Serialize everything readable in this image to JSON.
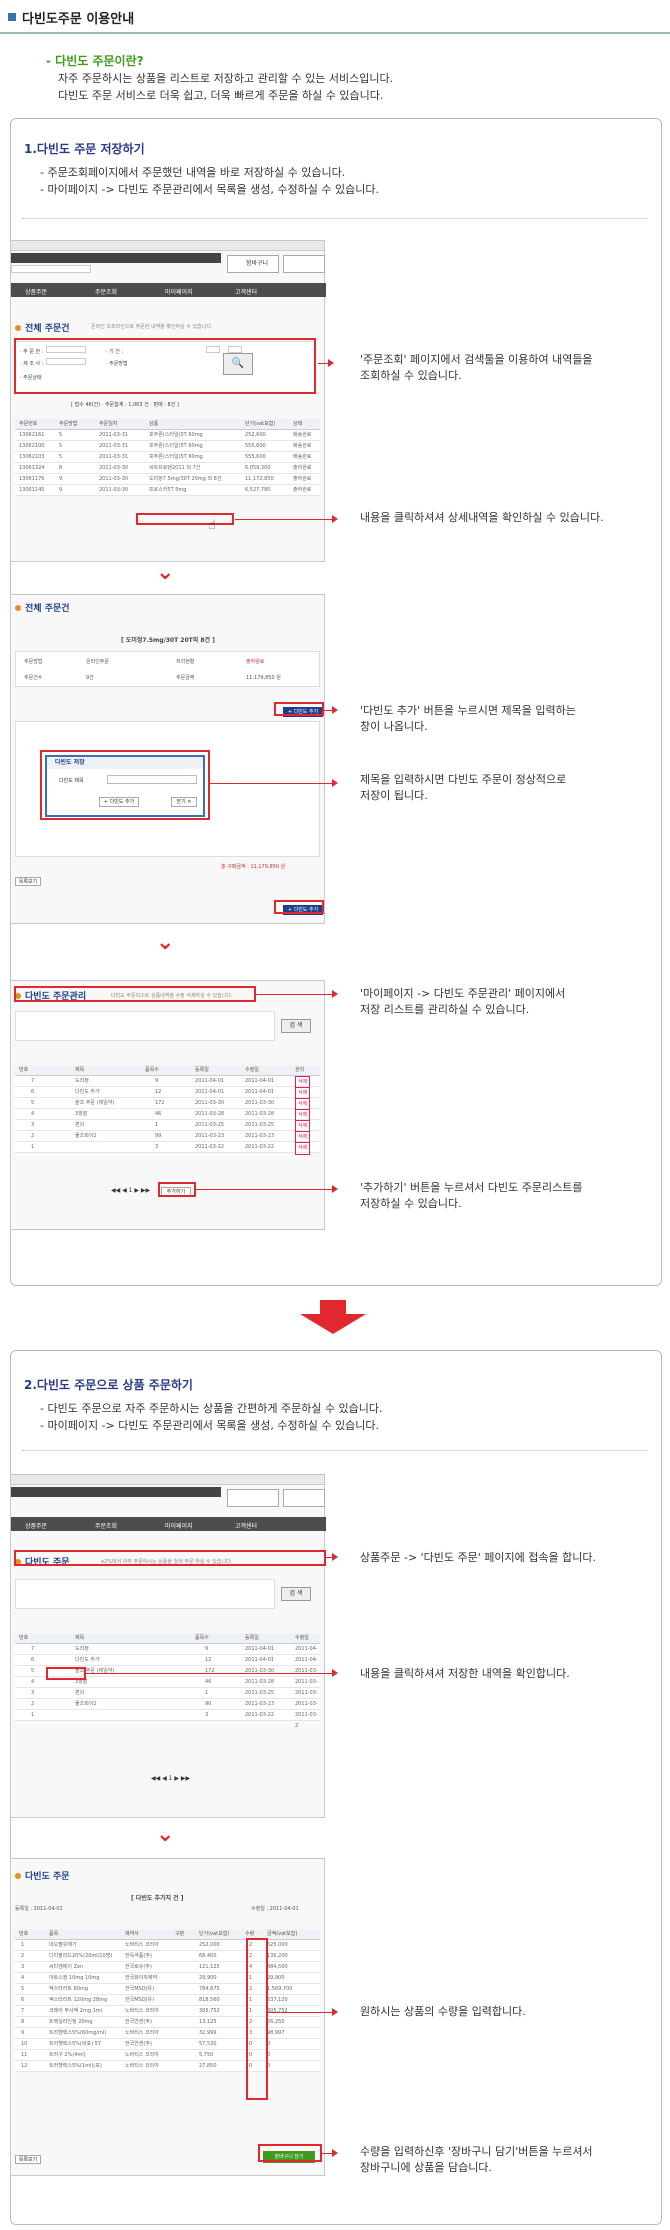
{
  "header": {
    "title": "다빈도주문 이용안내"
  },
  "intro": {
    "question": "- 다빈도 주문이란?",
    "line1": "자주 주문하시는 상품을 리스트로 저장하고 관리할 수 있는 서비스입니다.",
    "line2": "다빈도 주문 서비스로 더욱 쉽고, 더욱 빠르게 주문을 하실 수 있습니다."
  },
  "section1": {
    "title": "1.다빈도 주문 저장하기",
    "bullet1": "- 주문조회페이지에서 주문했던 내역을 바로 저장하실 수 있습니다.",
    "bullet2": "- 마이페이지 -> 다빈도 주문관리에서 목록을 생성, 수정하실 수 있습니다.",
    "annotations": {
      "a1_l1": "'주문조회' 페이지에서 검색툴을 이용하여 내역들을",
      "a1_l2": "조회하실 수 있습니다.",
      "a2": "내용을 클릭하셔셔 상세내역을 확인하실 수 있습니다.",
      "a3_l1": "'다빈도 추가' 버튼을 누르시면 제목을 입력하는",
      "a3_l2": "창이 나옵니다.",
      "a4_l1": "제목을 입력하시면 다빈도 주문이 정상적으로",
      "a4_l2": "저장이 됩니다.",
      "a5_l1": "'마이페이지 -> 다빈도 주문관리' 페이지에서",
      "a5_l2": "저장 리스트를 관리하실 수 있습니다.",
      "a6_l1": "'추가하기' 버튼을 누르셔서 다빈도 주문리스트를",
      "a6_l2": "저장하실 수 있습니다."
    },
    "shot1": {
      "nav": [
        "상품주문",
        "주문조회",
        "마이페이지",
        "고객센터"
      ],
      "cart": "장바구니",
      "section_title": "전체 주문건",
      "section_sub": "온라인 오프라인으로 주문한 내역을 확인하실 수 있습니다.",
      "form": {
        "order_no": "· 주 문 번 :",
        "period": "· 기 간 :",
        "product": "· 제 조 사 :",
        "method": "· 주문방법",
        "status": "· 주문상태"
      },
      "summary": "[ 접수 46(건) · 주문합계 : 1,063 건 · 판매 : 8건 ]",
      "headers": [
        "주문번호",
        "주문방법",
        "주문일자",
        "상품",
        "단가(vat포함)",
        "상태"
      ],
      "rows": [
        [
          "13062161",
          "5",
          "2011-03-31",
          "포주론(스터일)5T 60mg",
          "252,600",
          "배송완료"
        ],
        [
          "13062100",
          "5",
          "2011-03-31",
          "포주론(스터일)5T 60mg",
          "555,600",
          "배송완료"
        ],
        [
          "13062103",
          "5",
          "2011-03-31",
          "포주론(스터일)5T 60mg",
          "555,600",
          "배송완료"
        ],
        [
          "13061324",
          "8",
          "2011-03-30",
          "씨트프로텐2011 외 7건",
          "6,059,300",
          "출하완료"
        ],
        [
          "13061176",
          "9",
          "2011-03-30",
          "도미정7.5mg/30T 20mg 외 8건",
          "11,172,850",
          "출하완료"
        ],
        [
          "13061145",
          "9",
          "2011-03-30",
          "프로스카5T 5mg",
          "6,527,780",
          "출하완료"
        ]
      ]
    },
    "shot2": {
      "section_title": "전체 주문건",
      "order_title": "[ 도미정7.5mg/30T 20T외 8건 ]",
      "info": [
        "주문방법",
        "온라인주문",
        "처리현황",
        "출하완료",
        "주문건수",
        "9건",
        "주문금액",
        "11,179,850 원"
      ],
      "add_btn": "+ 다빈도 추가",
      "modal_title": "다빈도 저장",
      "modal_label": "다빈도 제목",
      "modal_add": "+ 다빈도 추가",
      "modal_close": "닫기 ✕",
      "total": "총 구매금액 : 11,179,850 원",
      "list_btn": "목록보기"
    },
    "shot3": {
      "section_title": "다빈도 주문관리",
      "section_sub": "다빈도 주문리스트 상품내역을 수정 삭제하실 수 있습니다.",
      "search_btn": "검 색",
      "headers": [
        "번호",
        "제목",
        "품목수",
        "등록일",
        "수정일",
        "관리"
      ],
      "rows": [
        [
          "7",
          "도리정",
          "9",
          "2011-04-01",
          "2011-04-01",
          "삭제"
        ],
        [
          "6",
          "다빈도 추가",
          "12",
          "2011-04-01",
          "2011-04-01",
          "삭제"
        ],
        [
          "5",
          "올조 주문 (제일약)",
          "172",
          "2011-03-30",
          "2011-03-30",
          "삭제"
        ],
        [
          "4",
          "3월말",
          "46",
          "2011-03-28",
          "2011-03-28",
          "삭제"
        ],
        [
          "3",
          "편의",
          "1",
          "2011-03-25",
          "2011-03-25",
          "삭제"
        ],
        [
          "2",
          "물조회이2",
          "99",
          "2011-03-23",
          "2011-03-23",
          "삭제"
        ],
        [
          "1",
          "",
          "3",
          "2011-03-22",
          "2011-03-22",
          "삭제"
        ]
      ],
      "add_btn": "추가하기",
      "pager": "1"
    }
  },
  "section2": {
    "title": "2.다빈도 주문으로 상품 주문하기",
    "bullet1": "- 다빈도 주문으로 자주 주문하시는 상품을 간편하게 주문하실 수 있습니다.",
    "bullet2": "- 마이페이지 -> 다빈도 주문관리에서 목록을 생성, 수정하실 수 있습니다.",
    "annotations": {
      "b1": "상품주문 -> '다빈도 주문' 페이지에 접속을 합니다.",
      "b2": "내용을 클릭하셔셔 저장한 내역을 확인합니다.",
      "b3": "원하시는 상품의 수량을 입력합니다.",
      "b4_l1": "수량을 입력하신후 '장바구니 담기'버튼을 누르셔서",
      "b4_l2": "장바구니에 상품을 담습니다."
    },
    "shot4": {
      "section_title": "다빈도 주문",
      "section_sub": "e2%에서 자주 주문하시는 상품을 검색 주문 하실 수 있습니다.",
      "search_btn": "검 색",
      "headers": [
        "번호",
        "제목",
        "품목수",
        "등록일",
        "수정일"
      ],
      "rows": [
        [
          "7",
          "도리정",
          "9",
          "2011-04-01",
          "2011-04-0"
        ],
        [
          "6",
          "다빈도 추가",
          "12",
          "2011-04-01",
          "2011-04-0"
        ],
        [
          "5",
          "올조 주문 (제일약)",
          "172",
          "2011-03-30",
          "2011-03-3"
        ],
        [
          "4",
          "3월말",
          "46",
          "2011-03-28",
          "2011-03-2"
        ],
        [
          "3",
          "편의",
          "1",
          "2011-03-25",
          "2011-03-2"
        ],
        [
          "2",
          "물조회이2",
          "90",
          "2011-03-23",
          "2011-03-2"
        ],
        [
          "1",
          "",
          "3",
          "2011-03-22",
          "2011-03-2"
        ]
      ]
    },
    "shot5": {
      "section_title": "다빈도 주문",
      "order_title": "[ 다빈도 추가지 건 ]",
      "reg": "등록일 : 2011-04-01",
      "mod": "수정일 : 2011-04-01",
      "headers": [
        "번호",
        "품목",
        "제약사",
        "구분",
        "단가(vat포함)",
        "수량",
        "금액(vat포함)"
      ],
      "rows": [
        [
          "1",
          "네오팔유메가",
          "노바티스 코리아",
          "",
          "252,000",
          "2",
          "525,000"
        ],
        [
          "2",
          "디티팔리드20%(20ml/10명)",
          "한독약품(주)",
          "",
          "68,400",
          "2",
          "136,200"
        ],
        [
          "3",
          "씨티엠에이 Zen",
          "한국로슈(주)",
          "",
          "121,125",
          "4",
          "484,500"
        ],
        [
          "4",
          "아토스정 10mg 10mg",
          "한국화이자제약",
          "",
          "29,900",
          "1",
          "29,900"
        ],
        [
          "5",
          "엑스타라트 60mg",
          "한국MSD(유)",
          "",
          "784,675",
          "2",
          "1,569,700"
        ],
        [
          "6",
          "엑스타라트 120mg 28mg",
          "한국MSD(유)",
          "",
          "818,560",
          "1",
          "637,120"
        ],
        [
          "7",
          "코레아 주사액 2mg 1ml",
          "노바티스 코리아",
          "",
          "305,752",
          "1",
          "305,752"
        ],
        [
          "8",
          "트렉실라인정 20mg",
          "한국얀센(주)",
          "",
          "13,125",
          "2",
          "26,250"
        ],
        [
          "9",
          "트리헬렉스5%(60mg/ml)",
          "노바티스 코리아",
          "",
          "32,999",
          "3",
          "98,997"
        ],
        [
          "10",
          "트리헬렉스5%(비포) 5T",
          "한국얀센(주)",
          "",
          "57,530",
          "0",
          "0"
        ],
        [
          "11",
          "트러구 2%(4ml)",
          "노바티스 코리아",
          "",
          "5,750",
          "0",
          "0"
        ],
        [
          "12",
          "트러헬렉스5%(1ml)(포)",
          "노바티스 코리아",
          "",
          "27,850",
          "0",
          "0"
        ]
      ],
      "cart_btn": "장바구니 담기",
      "list_btn": "목록보기"
    }
  }
}
